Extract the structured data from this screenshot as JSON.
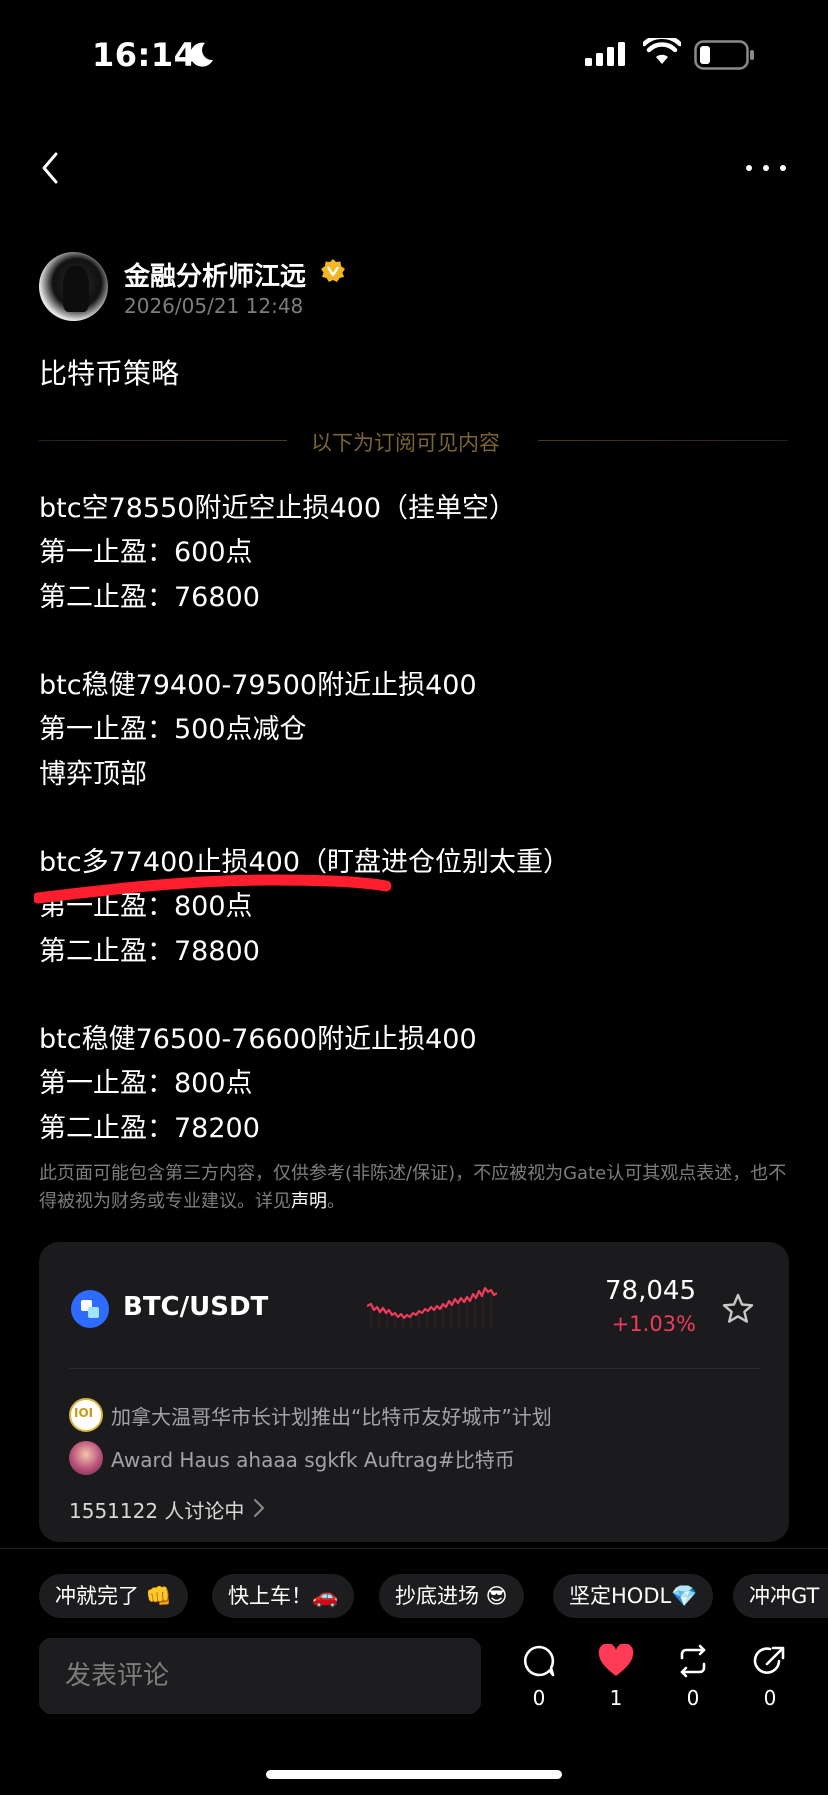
{
  "status_bar": {
    "time": "16:14"
  },
  "author": {
    "name": "金融分析师江远",
    "time": "2026/05/21 12:48"
  },
  "post": {
    "title": "比特币策略",
    "subscription_divider": "以下为订阅可见内容",
    "lines": [
      "btc空78550附近空止损400（挂单空）",
      "第一止盈：600点",
      "第二止盈：76800",
      "btc稳健79400-79500附近止损400",
      "第一止盈：500点减仓",
      "博弈顶部",
      "btc多77400止损400（盯盘进仓位别太重）",
      "第一止盈：800点",
      "第二止盈：78800",
      "btc稳健76500-76600附近止损400",
      "第一止盈：800点",
      "第二止盈：78200"
    ],
    "disclaimer": "此页面可能包含第三方内容，仅供参考(非陈述/保证)，不应被视为Gate认可其观点表述，也不得被视为财务或专业建议。详见",
    "disclaimer_link": "声明",
    "disclaimer_end": "。"
  },
  "market_card": {
    "pair": "BTC/USDT",
    "price": "78,045",
    "change": "+1.03%",
    "change_color": "#f23a5a",
    "news": [
      {
        "text": "加拿大温哥华市长计划推出“比特币友好城市”计划"
      },
      {
        "text": "Award Haus ahaaa sgkfk Auftrag#比特币"
      }
    ],
    "discussion": "1551122 人讨论中"
  },
  "quick_replies": [
    "冲就完了 👊",
    "快上车！🚗",
    "抄底进场 😎",
    "坚定HODL💎",
    "冲冲GT"
  ],
  "comment": {
    "placeholder": "发表评论"
  },
  "actions": [
    {
      "icon": "comment-icon",
      "count": "0"
    },
    {
      "icon": "heart-icon",
      "count": "1"
    },
    {
      "icon": "repost-icon",
      "count": "0"
    },
    {
      "icon": "share-icon",
      "count": "0"
    }
  ]
}
